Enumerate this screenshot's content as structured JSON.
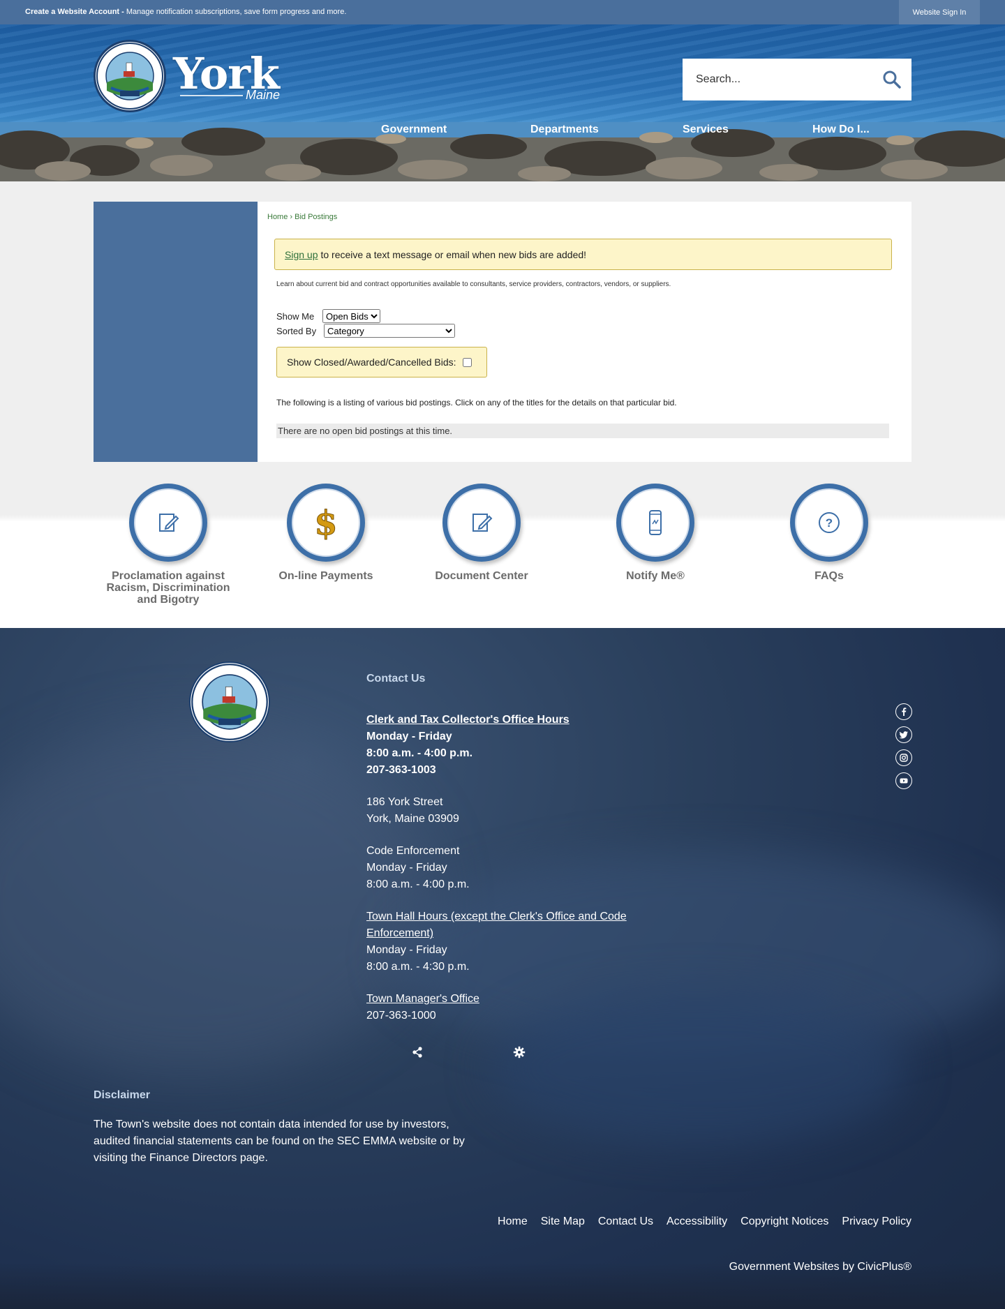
{
  "topbar": {
    "account_strong": "Create a Website Account -",
    "account_text": " Manage notification subscriptions, save form progress and more.",
    "signin": "Website Sign In"
  },
  "header": {
    "logo_word": "York",
    "logo_sub": "Maine",
    "search_placeholder": "Search...",
    "nav": [
      "Government",
      "Departments",
      "Services",
      "How Do I..."
    ]
  },
  "breadcrumb": {
    "home": "Home",
    "sep": " › ",
    "current": "Bid Postings"
  },
  "notice": {
    "link": "Sign up",
    "text": "to receive a text message or email when new bids are added!"
  },
  "intro": "Learn about current bid and contract opportunities available to consultants, service providers, contractors, vendors, or suppliers.",
  "filters": {
    "show_me_label": "Show Me",
    "show_me_value": "Open Bids",
    "sorted_by_label": "Sorted By",
    "sorted_by_value": "Category",
    "closed_label": "Show Closed/Awarded/Cancelled Bids:"
  },
  "listing_text": "The following is a listing of various bid postings. Click on any of the titles for the details on that particular bid.",
  "no_bids": "There are no open bid postings at this time.",
  "quick_links": [
    {
      "label": "Proclamation against Racism, Discrimination and Bigotry",
      "icon": "edit-document-icon"
    },
    {
      "label": "On-line Payments",
      "icon": "dollar-icon"
    },
    {
      "label": "Document Center",
      "icon": "edit-document-icon"
    },
    {
      "label": "Notify Me®",
      "icon": "mobile-phone-icon"
    },
    {
      "label": "FAQs",
      "icon": "question-icon"
    }
  ],
  "footer": {
    "contact_title": "Contact Us",
    "clerk_link": "Clerk and Tax Collector's Office Hours",
    "clerk_days": "Monday - Friday",
    "clerk_hours": "8:00 a.m. - 4:00 p.m.",
    "clerk_phone": "207-363-1003",
    "address1": "186 York Street",
    "address2": "York, Maine 03909",
    "code_title": "Code Enforcement",
    "code_days": "Monday - Friday",
    "code_hours": "8:00 a.m. - 4:00 p.m.",
    "townhall_link": "Town Hall Hours (except the Clerk's Office and Code Enforcement)",
    "townhall_days": "Monday - Friday",
    "townhall_hours": "8:00 a.m. - 4:30 p.m.",
    "manager_link": "Town Manager's Office",
    "manager_phone": "207-363-1000",
    "disclaimer_title": "Disclaimer",
    "disclaimer_text": "The Town's website does not contain data intended for use by investors, audited financial statements can be found on the SEC EMMA website or by visiting the Finance Directors page.",
    "links": [
      "Home",
      "Site Map",
      "Contact Us",
      "Accessibility",
      "Copyright Notices",
      "Privacy Policy"
    ],
    "civicplus": "Government Websites by CivicPlus®"
  },
  "colors": {
    "primary_blue": "#4a6f9c",
    "notice_bg": "#fdf5c9",
    "link_green": "#2e6f3a"
  }
}
